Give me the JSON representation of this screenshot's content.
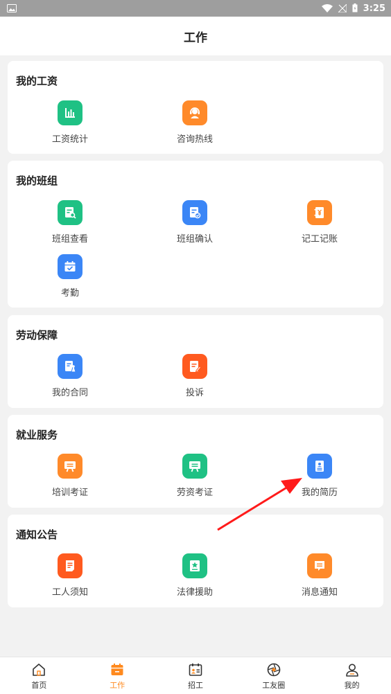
{
  "status_bar": {
    "time": "3:25"
  },
  "header": {
    "title": "工作"
  },
  "sections": [
    {
      "title": "我的工资",
      "items": [
        {
          "label": "工资统计",
          "icon": "bar-chart-icon",
          "color": "#1fc184"
        },
        {
          "label": "咨询热线",
          "icon": "headset-icon",
          "color": "#ff8a2a"
        }
      ]
    },
    {
      "title": "我的班组",
      "items": [
        {
          "label": "班组查看",
          "icon": "team-view-icon",
          "color": "#1fc184"
        },
        {
          "label": "班组确认",
          "icon": "team-confirm-icon",
          "color": "#3b86f6"
        },
        {
          "label": "记工记账",
          "icon": "ledger-icon",
          "color": "#ff8a2a"
        },
        {
          "label": "考勤",
          "icon": "attendance-calendar-icon",
          "color": "#3b86f6"
        }
      ]
    },
    {
      "title": "劳动保障",
      "items": [
        {
          "label": "我的合同",
          "icon": "contract-icon",
          "color": "#3b86f6"
        },
        {
          "label": "投诉",
          "icon": "complaint-icon",
          "color": "#ff5a1f"
        }
      ]
    },
    {
      "title": "就业服务",
      "items": [
        {
          "label": "培训考证",
          "icon": "training-board-icon",
          "color": "#ff8a2a"
        },
        {
          "label": "劳资考证",
          "icon": "labor-board-icon",
          "color": "#1fc184"
        },
        {
          "label": "我的简历",
          "icon": "resume-icon",
          "color": "#3b86f6"
        }
      ]
    },
    {
      "title": "通知公告",
      "items": [
        {
          "label": "工人须知",
          "icon": "notice-doc-icon",
          "color": "#ff5a1f"
        },
        {
          "label": "法律援助",
          "icon": "legal-star-icon",
          "color": "#1fc184"
        },
        {
          "label": "消息通知",
          "icon": "message-icon",
          "color": "#ff8a2a"
        }
      ]
    }
  ],
  "tabs": [
    {
      "label": "首页",
      "icon": "home-icon"
    },
    {
      "label": "工作",
      "icon": "work-calendar-icon",
      "active": true
    },
    {
      "label": "招工",
      "icon": "recruit-icon"
    },
    {
      "label": "工友圈",
      "icon": "circle-icon"
    },
    {
      "label": "我的",
      "icon": "profile-icon"
    }
  ],
  "colors": {
    "accent": "#ff8a1f",
    "arrow": "#ff1a1a"
  }
}
